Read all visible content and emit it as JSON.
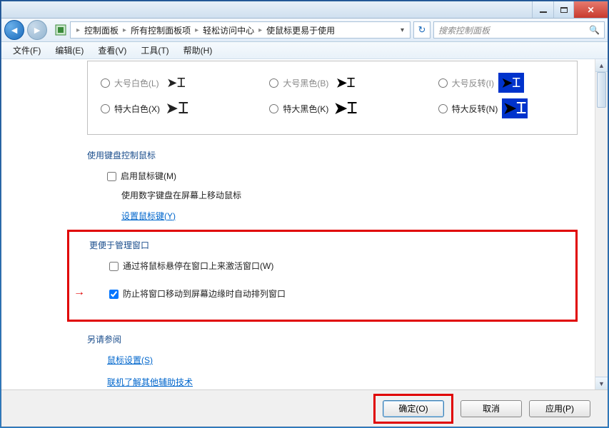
{
  "titlebar": {},
  "nav": {
    "breadcrumb": [
      "控制面板",
      "所有控制面板项",
      "轻松访问中心",
      "使鼠标更易于使用"
    ],
    "search_placeholder": "搜索控制面板"
  },
  "menu": {
    "file": "文件(F)",
    "edit": "编辑(E)",
    "view": "查看(V)",
    "tools": "工具(T)",
    "help": "帮助(H)"
  },
  "pointers": {
    "row1": [
      {
        "label": "大号白色(L)"
      },
      {
        "label": "大号黑色(B)"
      },
      {
        "label": "大号反转(I)"
      }
    ],
    "row2": [
      {
        "label": "特大白色(X)"
      },
      {
        "label": "特大黑色(K)"
      },
      {
        "label": "特大反转(N)"
      }
    ]
  },
  "sections": {
    "keyboard_title": "使用键盘控制鼠标",
    "enable_mousekeys": "启用鼠标键(M)",
    "mousekeys_desc": "使用数字键盘在屏幕上移动鼠标",
    "mousekeys_link": "设置鼠标键(Y)",
    "manage_title": "更便于管理窗口",
    "hover_activate": "通过将鼠标悬停在窗口上来激活窗口(W)",
    "prevent_arrange": "防止将窗口移动到屏幕边缘时自动排列窗口",
    "see_also": "另请参阅",
    "mouse_settings_link": "鼠标设置(S)",
    "assistive_link": "联机了解其他辅助技术"
  },
  "footer": {
    "ok": "确定(O)",
    "cancel": "取消",
    "apply": "应用(P)"
  }
}
